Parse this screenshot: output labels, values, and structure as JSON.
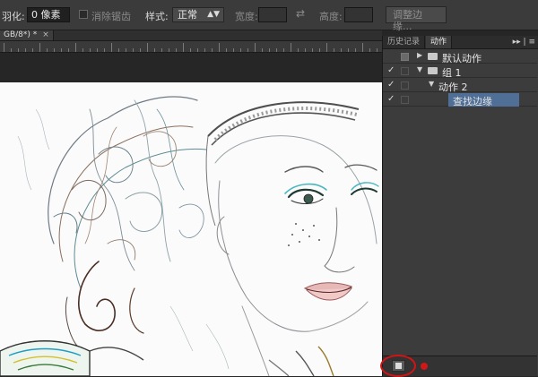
{
  "options_bar": {
    "feather_label": "羽化:",
    "feather_value": "0 像素",
    "antialias_label": "消除锯齿",
    "style_label": "样式:",
    "style_value": "正常",
    "width_label": "宽度:",
    "height_label": "高度:",
    "refine_edge_button": "调整边缘..."
  },
  "document_tab": {
    "title": "GB/8*) *",
    "close_symbol": "×"
  },
  "panel": {
    "tabs": [
      {
        "label": "历史记录",
        "active": false
      },
      {
        "label": "动作",
        "active": true
      }
    ],
    "menu_symbol": "▸▸ | ≡",
    "actions": [
      {
        "label": "默认动作",
        "checked": false,
        "expanded": false,
        "type": "set",
        "dialog_fill": true
      },
      {
        "label": "组 1",
        "checked": true,
        "expanded": true,
        "type": "set"
      },
      {
        "label": "动作 2",
        "checked": true,
        "expanded": true,
        "type": "action"
      },
      {
        "label": "查找边缘",
        "checked": true,
        "selected": true,
        "type": "command"
      }
    ],
    "check_symbol": "✓"
  },
  "colors": {
    "accent_selection": "#4f6f96",
    "record_red": "#d01818",
    "annotation_red": "#d41414"
  }
}
